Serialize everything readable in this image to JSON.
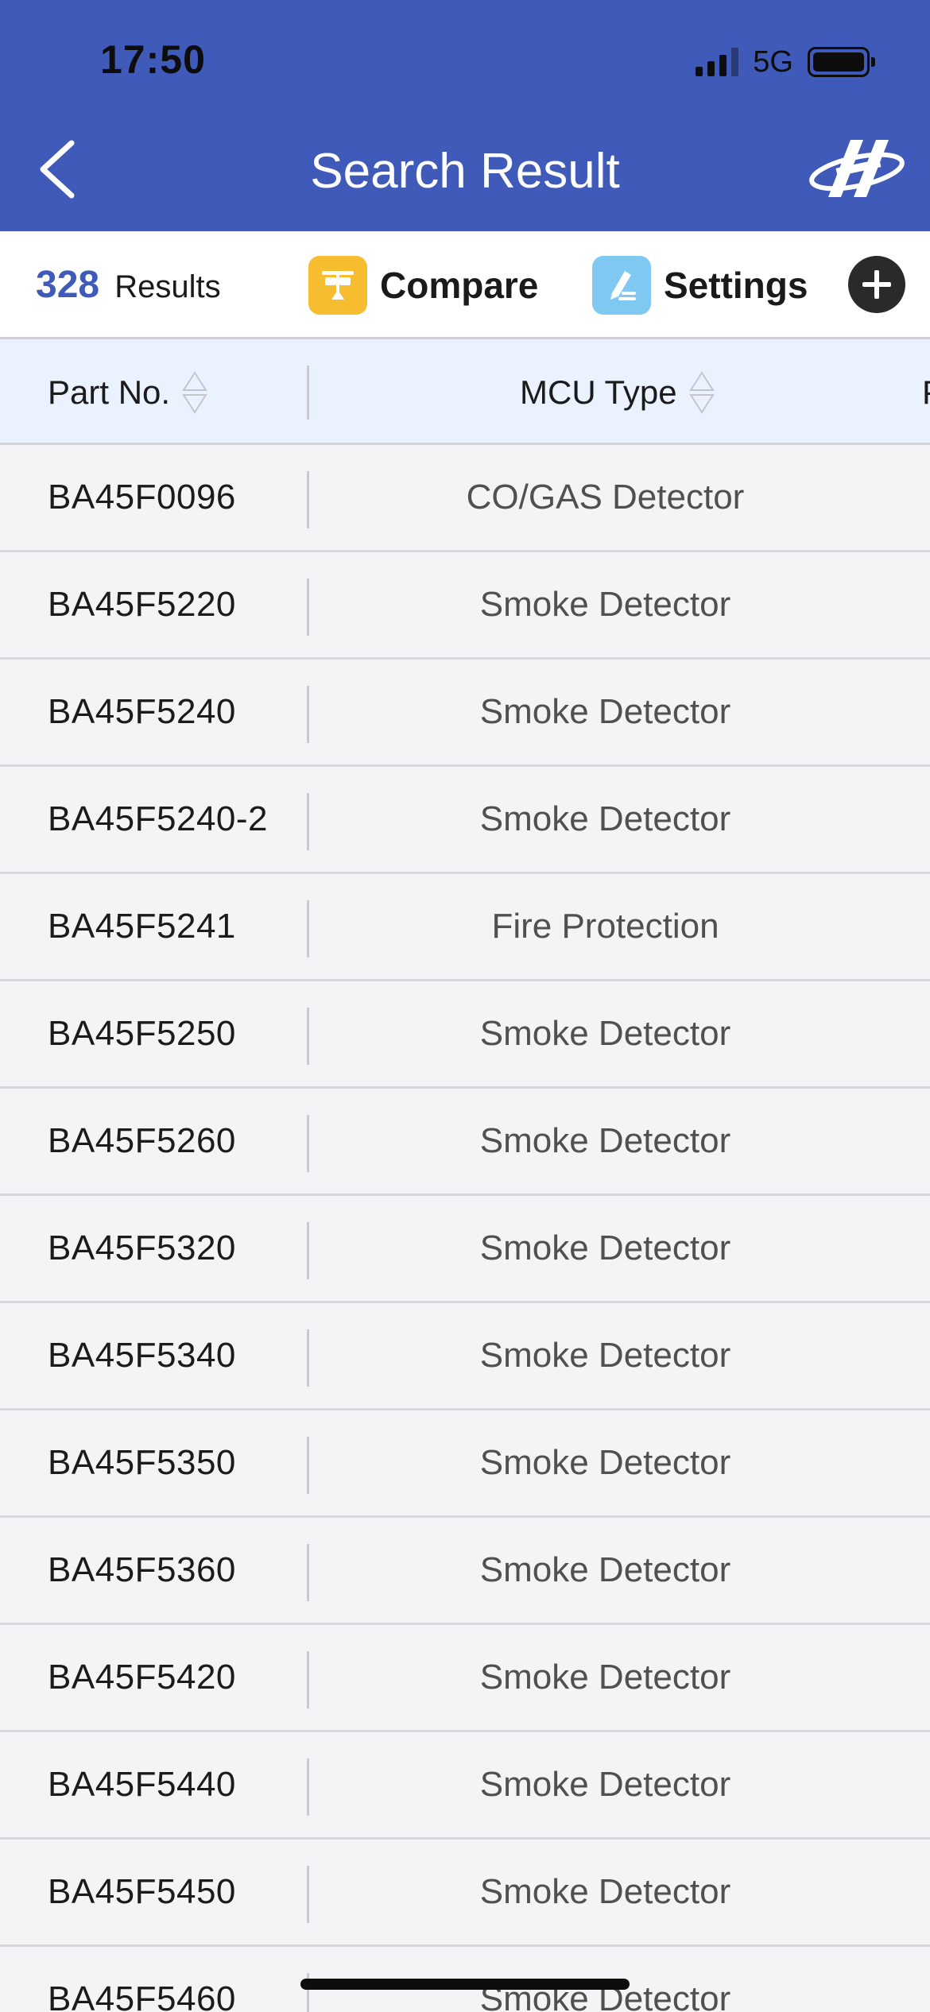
{
  "status_bar": {
    "time": "17:50",
    "network": "5G"
  },
  "header": {
    "title": "Search Result",
    "back_icon": "chevron-left-icon",
    "logo_icon": "brand-logo-icon",
    "background_color": "#3f5ab8"
  },
  "toolbar": {
    "count": "328",
    "count_label": "Results",
    "compare_label": "Compare",
    "settings_label": "Settings",
    "compare_color": "#f5bd2f",
    "settings_color": "#7fc8f2"
  },
  "table": {
    "columns": [
      "Part No.",
      "MCU Type",
      "P"
    ],
    "rows": [
      {
        "part": "BA45F0096",
        "mcu": "CO/GAS Detector"
      },
      {
        "part": "BA45F5220",
        "mcu": "Smoke Detector"
      },
      {
        "part": "BA45F5240",
        "mcu": "Smoke Detector"
      },
      {
        "part": "BA45F5240-2",
        "mcu": "Smoke Detector"
      },
      {
        "part": "BA45F5241",
        "mcu": "Fire Protection"
      },
      {
        "part": "BA45F5250",
        "mcu": "Smoke Detector"
      },
      {
        "part": "BA45F5260",
        "mcu": "Smoke Detector"
      },
      {
        "part": "BA45F5320",
        "mcu": "Smoke Detector"
      },
      {
        "part": "BA45F5340",
        "mcu": "Smoke Detector"
      },
      {
        "part": "BA45F5350",
        "mcu": "Smoke Detector"
      },
      {
        "part": "BA45F5360",
        "mcu": "Smoke Detector"
      },
      {
        "part": "BA45F5420",
        "mcu": "Smoke Detector"
      },
      {
        "part": "BA45F5440",
        "mcu": "Smoke Detector"
      },
      {
        "part": "BA45F5450",
        "mcu": "Smoke Detector"
      },
      {
        "part": "BA45F5460",
        "mcu": "Smoke Detector"
      }
    ]
  }
}
